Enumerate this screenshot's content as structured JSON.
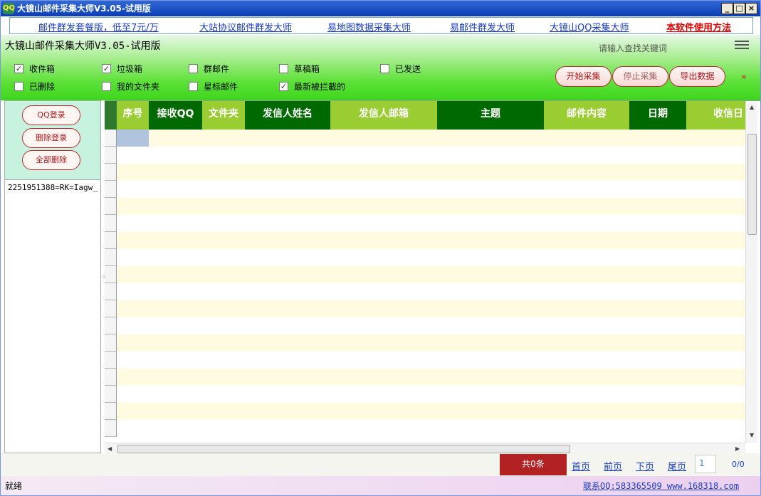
{
  "window": {
    "title": "大镜山邮件采集大师V3.05-试用版",
    "icon_text": "QQ",
    "controls": [
      "_",
      "□",
      "×"
    ]
  },
  "links": [
    "邮件群发套餐版，低至7元/万",
    "大站协议邮件群发大师",
    "易地图数据采集大师",
    "易邮件群发大师",
    "大镜山QQ采集大师",
    "本软件使用方法"
  ],
  "header": {
    "app_title": "大镜山邮件采集大师V3.05-试用版",
    "search_hint": "请输入查找关键词"
  },
  "folders": [
    {
      "label": "收件箱",
      "checked": true
    },
    {
      "label": "垃圾箱",
      "checked": true
    },
    {
      "label": "群邮件",
      "checked": false
    },
    {
      "label": "草稿箱",
      "checked": false
    },
    {
      "label": "已发送",
      "checked": false
    },
    {
      "label": "已删除",
      "checked": false
    },
    {
      "label": "我的文件夹",
      "checked": false
    },
    {
      "label": "星标邮件",
      "checked": false
    },
    {
      "label": "最新被拦截的",
      "checked": true
    }
  ],
  "actions": {
    "start": "开始采集",
    "stop": "停止采集",
    "export": "导出数据",
    "more": "»"
  },
  "account_panel": {
    "login": "QQ登录",
    "delete_login": "删除登录",
    "delete_all": "全部删除",
    "accounts": [
      "2251951388=RK=Iagw_"
    ]
  },
  "grid": {
    "columns": [
      "序号",
      "接收QQ",
      "文件夹",
      "发信人姓名",
      "发信人邮箱",
      "主题",
      "邮件内容",
      "日期",
      "收信日"
    ]
  },
  "pager": {
    "total": "共0条",
    "first": "首页",
    "prev": "前页",
    "next": "下页",
    "last": "尾页",
    "current_page": "1",
    "page_count": "0/0"
  },
  "status": {
    "text": "就绪",
    "contact": "联系QQ:583365509 www.168318.com"
  },
  "colors": {
    "header_dark": "#006a00",
    "header_light": "#9acd32",
    "row_alt": "#fffbe0",
    "accent_red": "#b22222",
    "link_blue": "#1a3ec8"
  }
}
